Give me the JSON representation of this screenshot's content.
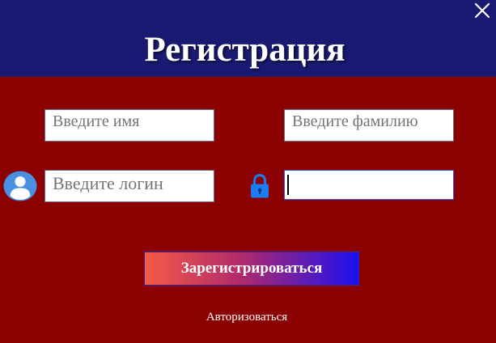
{
  "window": {
    "title": "Регистрация",
    "close_icon": "close-icon"
  },
  "form": {
    "first_name_placeholder": "Введите имя",
    "last_name_placeholder": "Введите фамилию",
    "login_placeholder": "Введите логин",
    "password_value": "",
    "user_icon": "user-icon",
    "lock_icon": "lock-icon"
  },
  "actions": {
    "register_label": "Зарегистрироваться",
    "login_link": "Авторизоваться"
  },
  "colors": {
    "header_bg": "#1a1a72",
    "body_bg": "#8b0000",
    "icon_blue": "#1e7cf2",
    "button_gradient_start": "#f55a45",
    "button_gradient_end": "#1d10f0"
  }
}
